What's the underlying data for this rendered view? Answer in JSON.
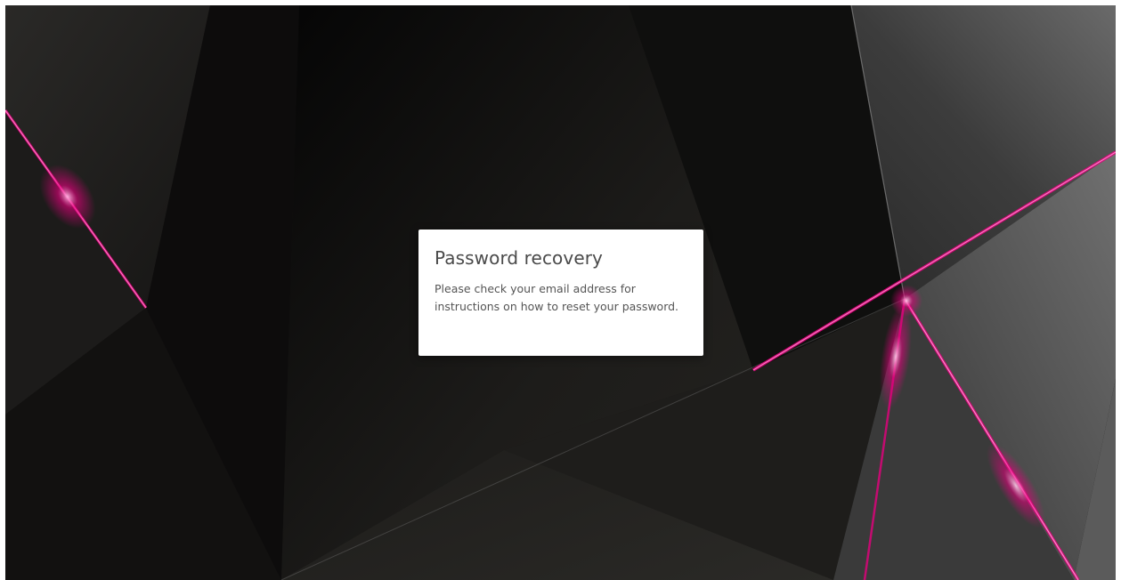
{
  "page": {
    "background_theme": "dark-polygonal-with-magenta-light-streaks",
    "colors": {
      "background_dark": "#141312",
      "accent_magenta": "#e6007e",
      "card_background": "#ffffff",
      "title_text": "#4a4a4a",
      "body_text": "#555555"
    }
  },
  "dialog": {
    "title": "Password recovery",
    "message": "Please check your email address for instructions on how to reset your password."
  }
}
